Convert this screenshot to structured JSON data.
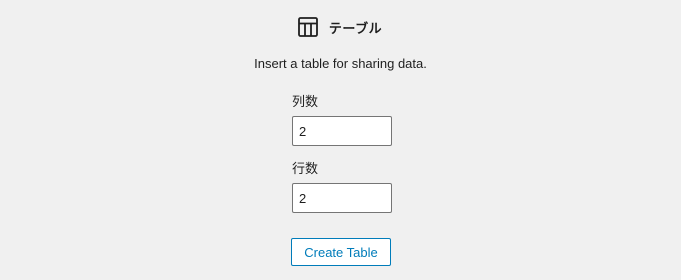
{
  "block": {
    "icon": "table-icon",
    "title": "テーブル",
    "instructions": "Insert a table for sharing data."
  },
  "form": {
    "columns_label": "列数",
    "columns_value": "2",
    "rows_label": "行数",
    "rows_value": "2",
    "submit_label": "Create Table"
  },
  "colors": {
    "background": "#f0f0f0",
    "text": "#1e1e1e",
    "accent": "#007cba",
    "input_border": "#757575"
  }
}
